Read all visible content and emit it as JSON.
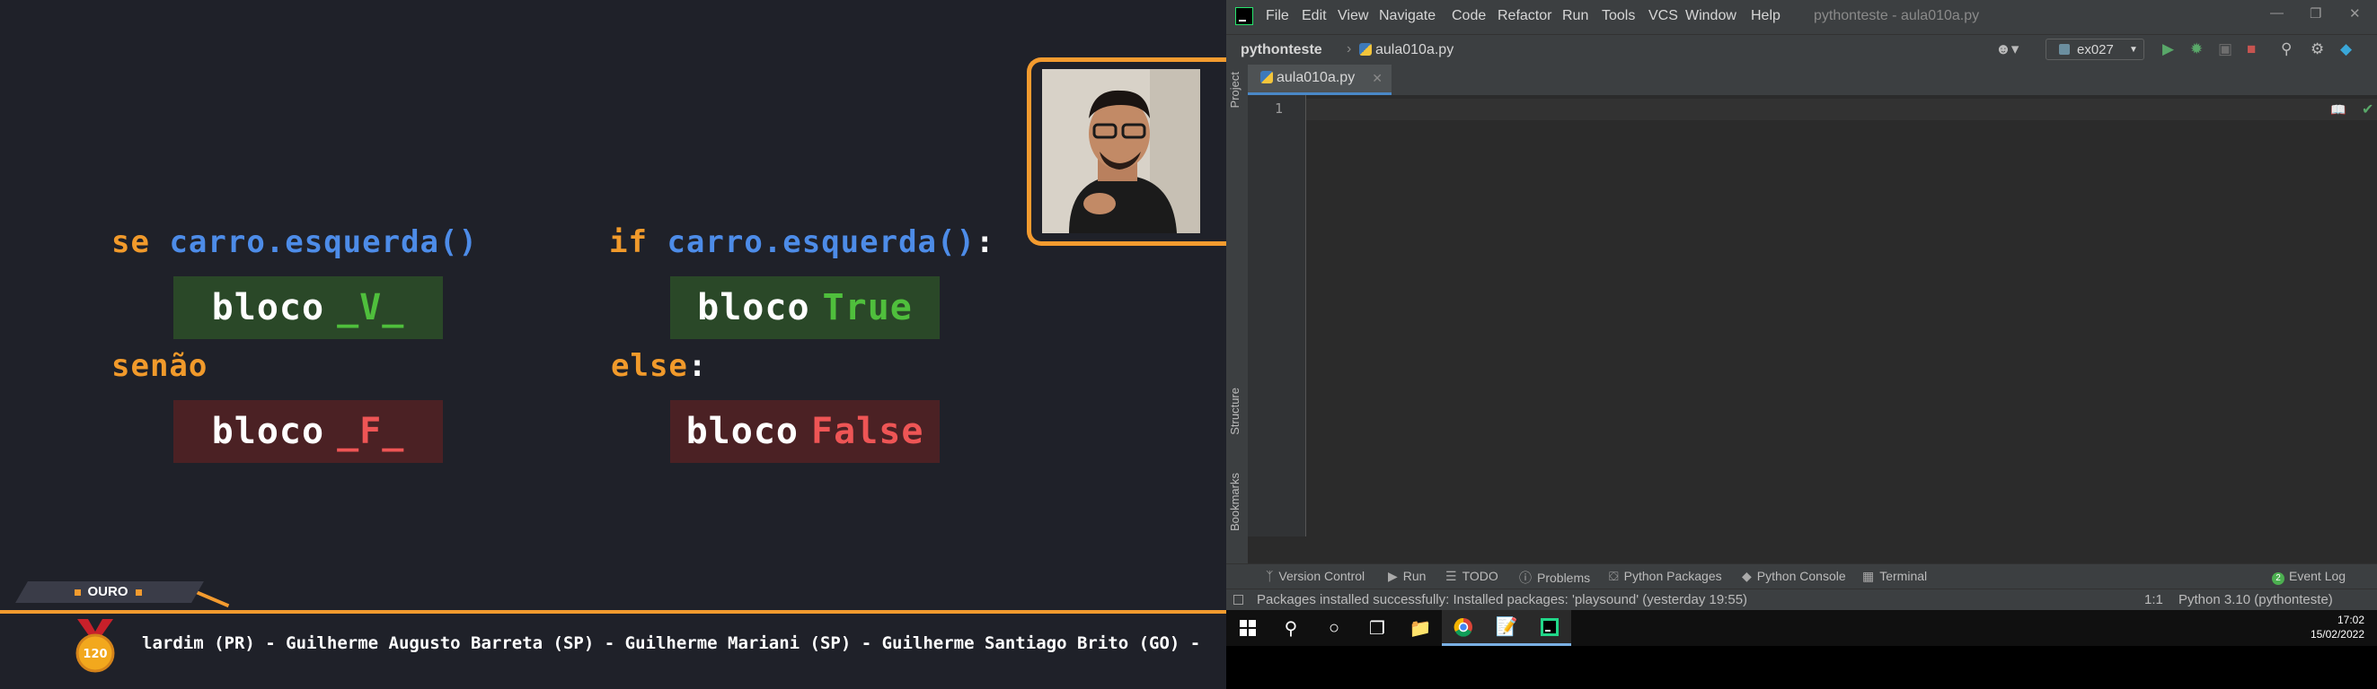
{
  "slide": {
    "pt": {
      "kw_if": "se",
      "call": "carro.esquerda()",
      "block_true_word": "bloco",
      "block_true_value": "_V_",
      "kw_else": "senão",
      "block_false_word": "bloco",
      "block_false_value": "_F_"
    },
    "py": {
      "kw_if": "if",
      "call": "carro.esquerda()",
      "colon": ":",
      "block_true_word": "bloco",
      "block_true_value": "True",
      "kw_else": "else",
      "else_colon": ":",
      "block_false_word": "bloco",
      "block_false_value": "False"
    },
    "ticker": {
      "tab_label": "OURO",
      "medal_number": "120",
      "text": "lardim (PR) - Guilherme Augusto Barreta (SP) - Guilherme Mariani (SP) - Guilherme Santiago Brito (GO) -"
    },
    "colors": {
      "orange": "#f19a2b",
      "blue": "#4d8ce8",
      "green": "#4fbf3c",
      "red": "#ee5555"
    }
  },
  "ide": {
    "menu": [
      "File",
      "Edit",
      "View",
      "Navigate",
      "Code",
      "Refactor",
      "Run",
      "Tools",
      "VCS",
      "Window",
      "Help"
    ],
    "window_title": "pythonteste - aula010a.py",
    "breadcrumb": {
      "project": "pythonteste",
      "file": "aula010a.py"
    },
    "run_config": "ex027",
    "side_tabs": {
      "project": "Project",
      "structure": "Structure",
      "bookmarks": "Bookmarks"
    },
    "editor_tab": "aula010a.py",
    "line_number": "1",
    "bottom_tabs": {
      "version_control": "Version Control",
      "run": "Run",
      "todo": "TODO",
      "problems": "Problems",
      "python_packages": "Python Packages",
      "python_console": "Python Console",
      "terminal": "Terminal",
      "event_log": "Event Log",
      "event_count": "2"
    },
    "status": {
      "message": "Packages installed successfully: Installed packages: 'playsound' (yesterday 19:55)",
      "position": "1:1",
      "interpreter": "Python 3.10 (pythonteste)"
    }
  },
  "taskbar": {
    "time": "17:02",
    "date": "15/02/2022"
  }
}
